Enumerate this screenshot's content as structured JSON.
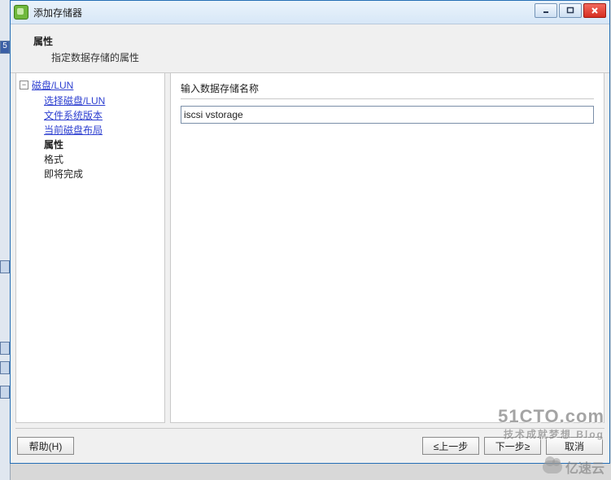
{
  "window": {
    "title": "添加存储器"
  },
  "header": {
    "title": "属性",
    "subtitle": "指定数据存储的属性"
  },
  "tree": {
    "root": "磁盘/LUN",
    "children": [
      "选择磁盘/LUN",
      "文件系统版本",
      "当前磁盘布局"
    ],
    "current": "属性",
    "after": [
      "格式",
      "即将完成"
    ]
  },
  "main": {
    "section_label": "输入数据存储名称",
    "input_value": "iscsi vstorage"
  },
  "footer": {
    "help": "帮助(H)",
    "back": "≤上一步",
    "next": "下一步≥",
    "cancel": "取消"
  },
  "watermarks": {
    "line1": "51CTO.com",
    "line2": "技术成就梦想 Blog",
    "line3": "亿速云"
  }
}
